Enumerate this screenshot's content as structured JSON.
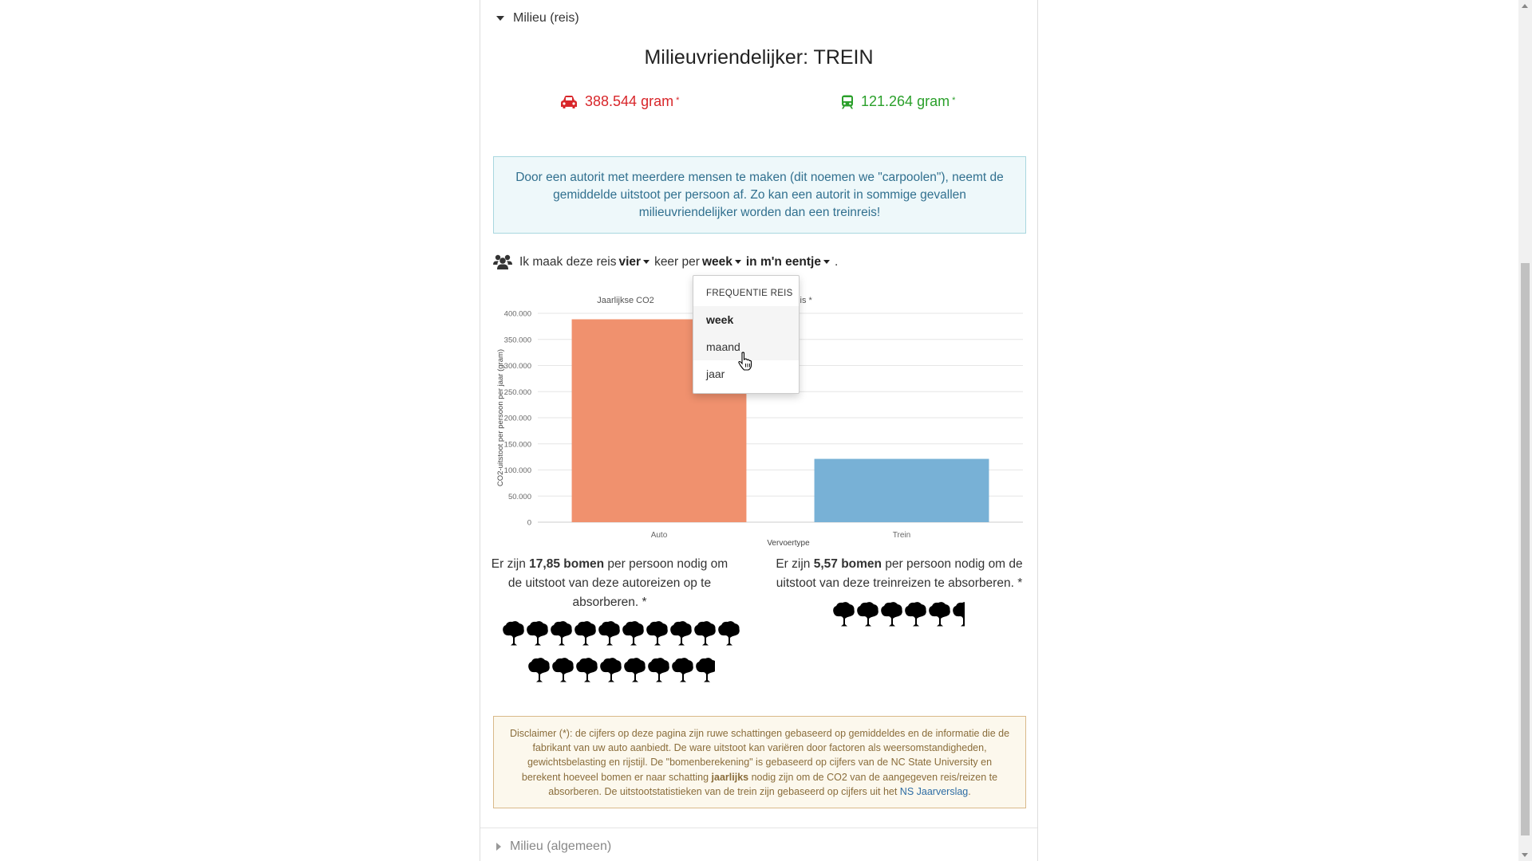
{
  "section": {
    "title": "Milieu (reis)"
  },
  "headline": "Milieuvriendelijker: TREIN",
  "stats": {
    "car": {
      "value": "388.544 gram",
      "asterisk": "*",
      "color": "#d8262a",
      "icon": "car-icon"
    },
    "train": {
      "value": "121.264 gram",
      "asterisk": "*",
      "color": "#2ba02b",
      "icon": "train-icon"
    }
  },
  "info_text": "Door een autorit met meerdere mensen te maken (dit noemen we \"carpoolen\"), neemt de gemiddelde uitstoot per persoon af. Zo kan een autorit in sommige gevallen milieuvriendelijker worden dan een treinreis!",
  "frequency": {
    "icon": "people-icon",
    "prefix": "Ik maak deze reis",
    "count": "vier",
    "middle": "keer per",
    "period": "week",
    "company": "in m'n eentje",
    "suffix": "."
  },
  "dropdown": {
    "header": "FREQUENTIE REIS",
    "items": [
      "week",
      "maand",
      "jaar"
    ],
    "selected": "week",
    "hovered": "maand"
  },
  "chart_data": {
    "type": "bar",
    "title_left": "Jaarlijkse CO2",
    "title_right": "utoreis vs. treinreis *",
    "categories": [
      "Auto",
      "Trein"
    ],
    "values": [
      388544,
      121264
    ],
    "colors": [
      "#f0916e",
      "#78b1d6"
    ],
    "xlabel": "Vervoertype",
    "ylabel": "CO2-uitstoot per persoon per jaar (gram)",
    "yticks": [
      "0",
      "50.000",
      "100.000",
      "150.000",
      "200.000",
      "250.000",
      "300.000",
      "350.000",
      "400.000"
    ],
    "ylim": [
      0,
      400000
    ],
    "grid": true
  },
  "trees": {
    "car": {
      "prefix": "Er zijn ",
      "count": "17,85 bomen",
      "suffix": " per persoon nodig om de uitstoot van deze autoreizen op te absorberen. *",
      "amount": 17.85
    },
    "train": {
      "prefix": "Er zijn ",
      "count": "5,57 bomen",
      "suffix": " per persoon nodig om de uitstoot van deze treinreizen te absorberen. *",
      "amount": 5.57
    },
    "icon": "tree-icon"
  },
  "disclaimer": {
    "part1": "Disclaimer (*): de cijfers op deze pagina zijn ruwe schattingen gebaseerd op gemiddeldes en de informatie die de fabrikant van uw auto aanbiedt. De ware uitstoot kan variëren door factoren als weersomstandigheden, gewichtsbelasting en rijstijl. De \"bomenberekening\" is gebaseerd op cijfers van de NC State University en berekent hoeveel bomen er naar schatting ",
    "bold": "jaarlijks",
    "part2": " nodig zijn om de CO2 van de aangegeven reis/reizen te absorberen. De uitstootstatistieken van de trein zijn gebaseerd op cijfers uit het ",
    "link": "NS Jaarverslag",
    "part3": "."
  },
  "section2": {
    "title": "Milieu (algemeen)"
  }
}
